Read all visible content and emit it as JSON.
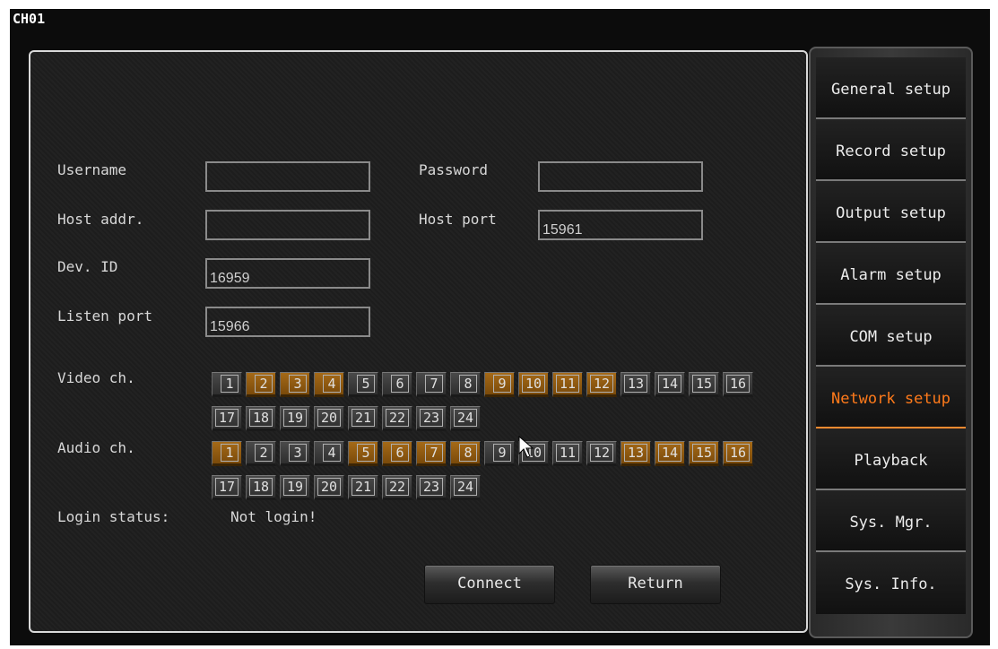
{
  "window": {
    "channel_label": "CH01"
  },
  "form": {
    "username": {
      "label": "Username",
      "value": ""
    },
    "password": {
      "label": "Password",
      "value": ""
    },
    "host_addr": {
      "label": "Host addr.",
      "value": ""
    },
    "host_port": {
      "label": "Host port",
      "value": "15961"
    },
    "dev_id": {
      "label": "Dev. ID",
      "value": "16959"
    },
    "listen_port": {
      "label": "Listen port",
      "value": "15966"
    }
  },
  "video": {
    "label": "Video ch.",
    "channels": [
      "1",
      "2",
      "3",
      "4",
      "5",
      "6",
      "7",
      "8",
      "9",
      "10",
      "11",
      "12",
      "13",
      "14",
      "15",
      "16",
      "17",
      "18",
      "19",
      "20",
      "21",
      "22",
      "23",
      "24"
    ],
    "selected": [
      2,
      3,
      4,
      9,
      10,
      11,
      12
    ]
  },
  "audio": {
    "label": "Audio ch.",
    "channels": [
      "1",
      "2",
      "3",
      "4",
      "5",
      "6",
      "7",
      "8",
      "9",
      "10",
      "11",
      "12",
      "13",
      "14",
      "15",
      "16",
      "17",
      "18",
      "19",
      "20",
      "21",
      "22",
      "23",
      "24"
    ],
    "selected": [
      1,
      5,
      6,
      7,
      8,
      13,
      14,
      15,
      16
    ]
  },
  "login": {
    "label": "Login status:",
    "value": "Not login!"
  },
  "buttons": {
    "connect": "Connect",
    "return": "Return"
  },
  "sidebar": {
    "items": [
      {
        "label": "General setup"
      },
      {
        "label": "Record setup"
      },
      {
        "label": "Output setup"
      },
      {
        "label": "Alarm setup"
      },
      {
        "label": "COM setup"
      },
      {
        "label": "Network setup"
      },
      {
        "label": "Playback"
      },
      {
        "label": "Sys. Mgr."
      },
      {
        "label": "Sys. Info."
      }
    ],
    "active_index": 5
  },
  "colors": {
    "accent": "#ff7a1a",
    "selected_channel": "#a56a18"
  }
}
